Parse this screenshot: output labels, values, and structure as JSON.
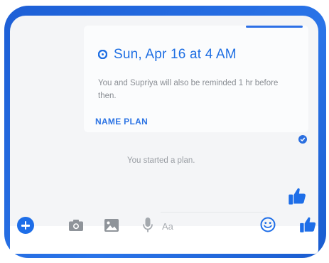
{
  "event": {
    "title": "Sun, Apr 16 at 4 AM",
    "description": "You and Supriya will also be reminded 1 hr before then.",
    "name_plan_label": "NAME PLAN"
  },
  "status": {
    "started_text": "You started a plan."
  },
  "composer": {
    "placeholder": "Aa"
  },
  "icons": {
    "add": "plus-circle-icon",
    "camera": "camera-icon",
    "gallery": "image-icon",
    "mic": "microphone-icon",
    "emoji": "smiley-icon",
    "like": "thumbs-up-icon"
  },
  "colors": {
    "accent": "#1f6fe3",
    "frame": "#2a74e8"
  }
}
